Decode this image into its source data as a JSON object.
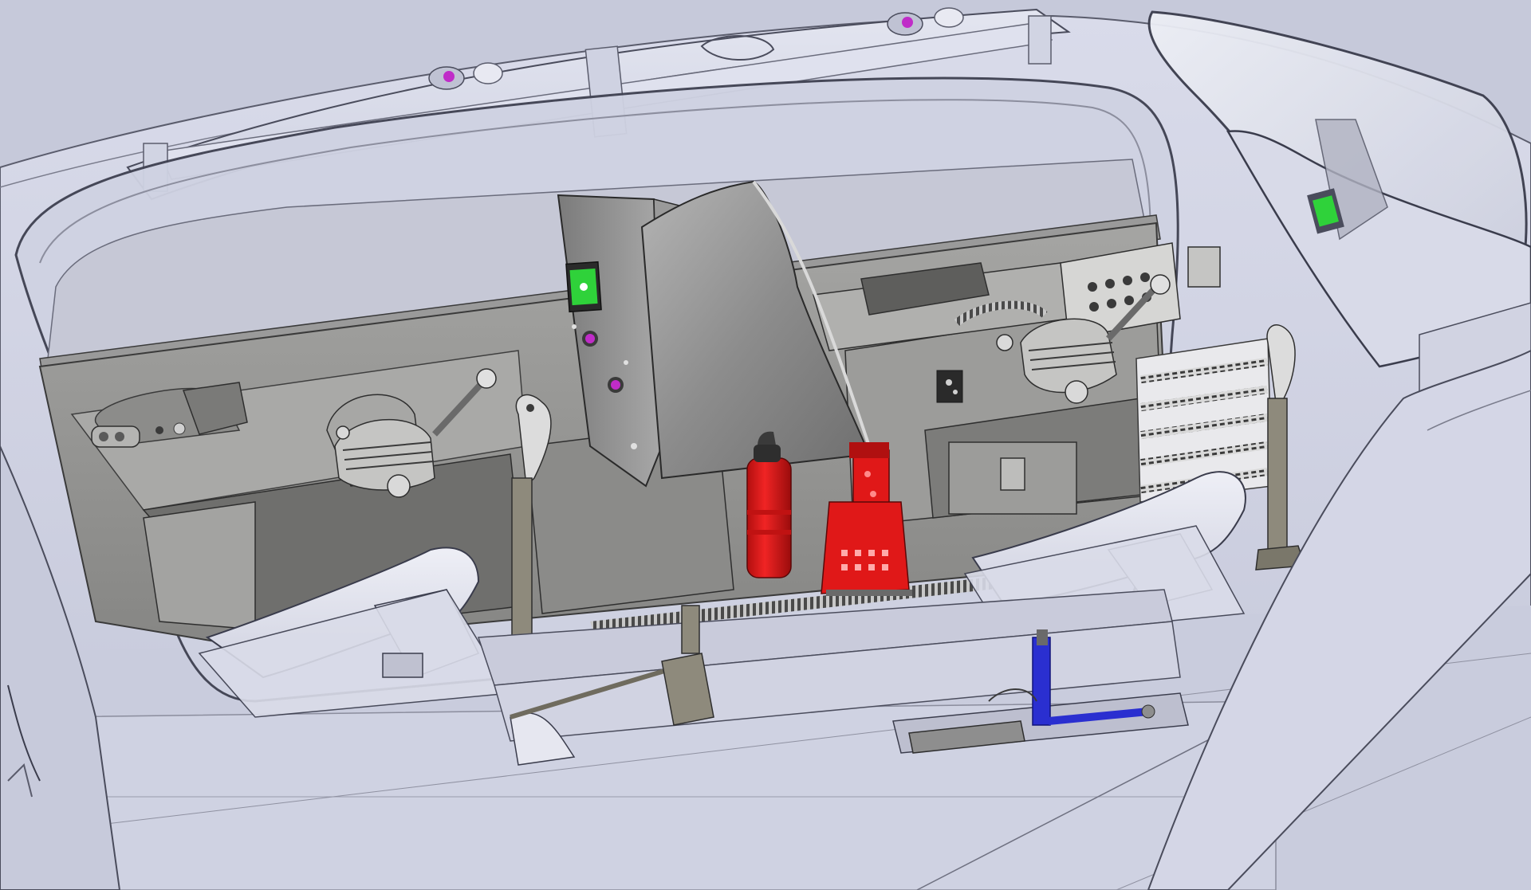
{
  "scene": {
    "colors": {
      "background": "#c8cbdc",
      "canopy_glass": "#d9dcea",
      "fuselage_light": "#d4d6e6",
      "fuselage_mid": "#b9bccf",
      "cockpit_dark": "#8e8e8c",
      "cockpit_floor": "#7c7c7a",
      "console_gray": "#9b9b99",
      "panel_dark": "#6d6d6d",
      "seat_white": "#e4e5ee",
      "edge_line": "#3a3b48",
      "display_green": "#2fd23a",
      "knob_magenta": "#c02cc8",
      "extinguisher_red": "#e01818",
      "pedal_blue": "#2a2fd0"
    },
    "components": [
      "canopy-frame-icon",
      "instrument-panel-icon",
      "display-screen-icon",
      "throttle-quadrant-icon",
      "control-stick-icon",
      "fire-extinguisher-icon",
      "ejection-handle-icon",
      "rudder-pedal-icon",
      "seat-shell-icon",
      "side-window-icon"
    ]
  }
}
